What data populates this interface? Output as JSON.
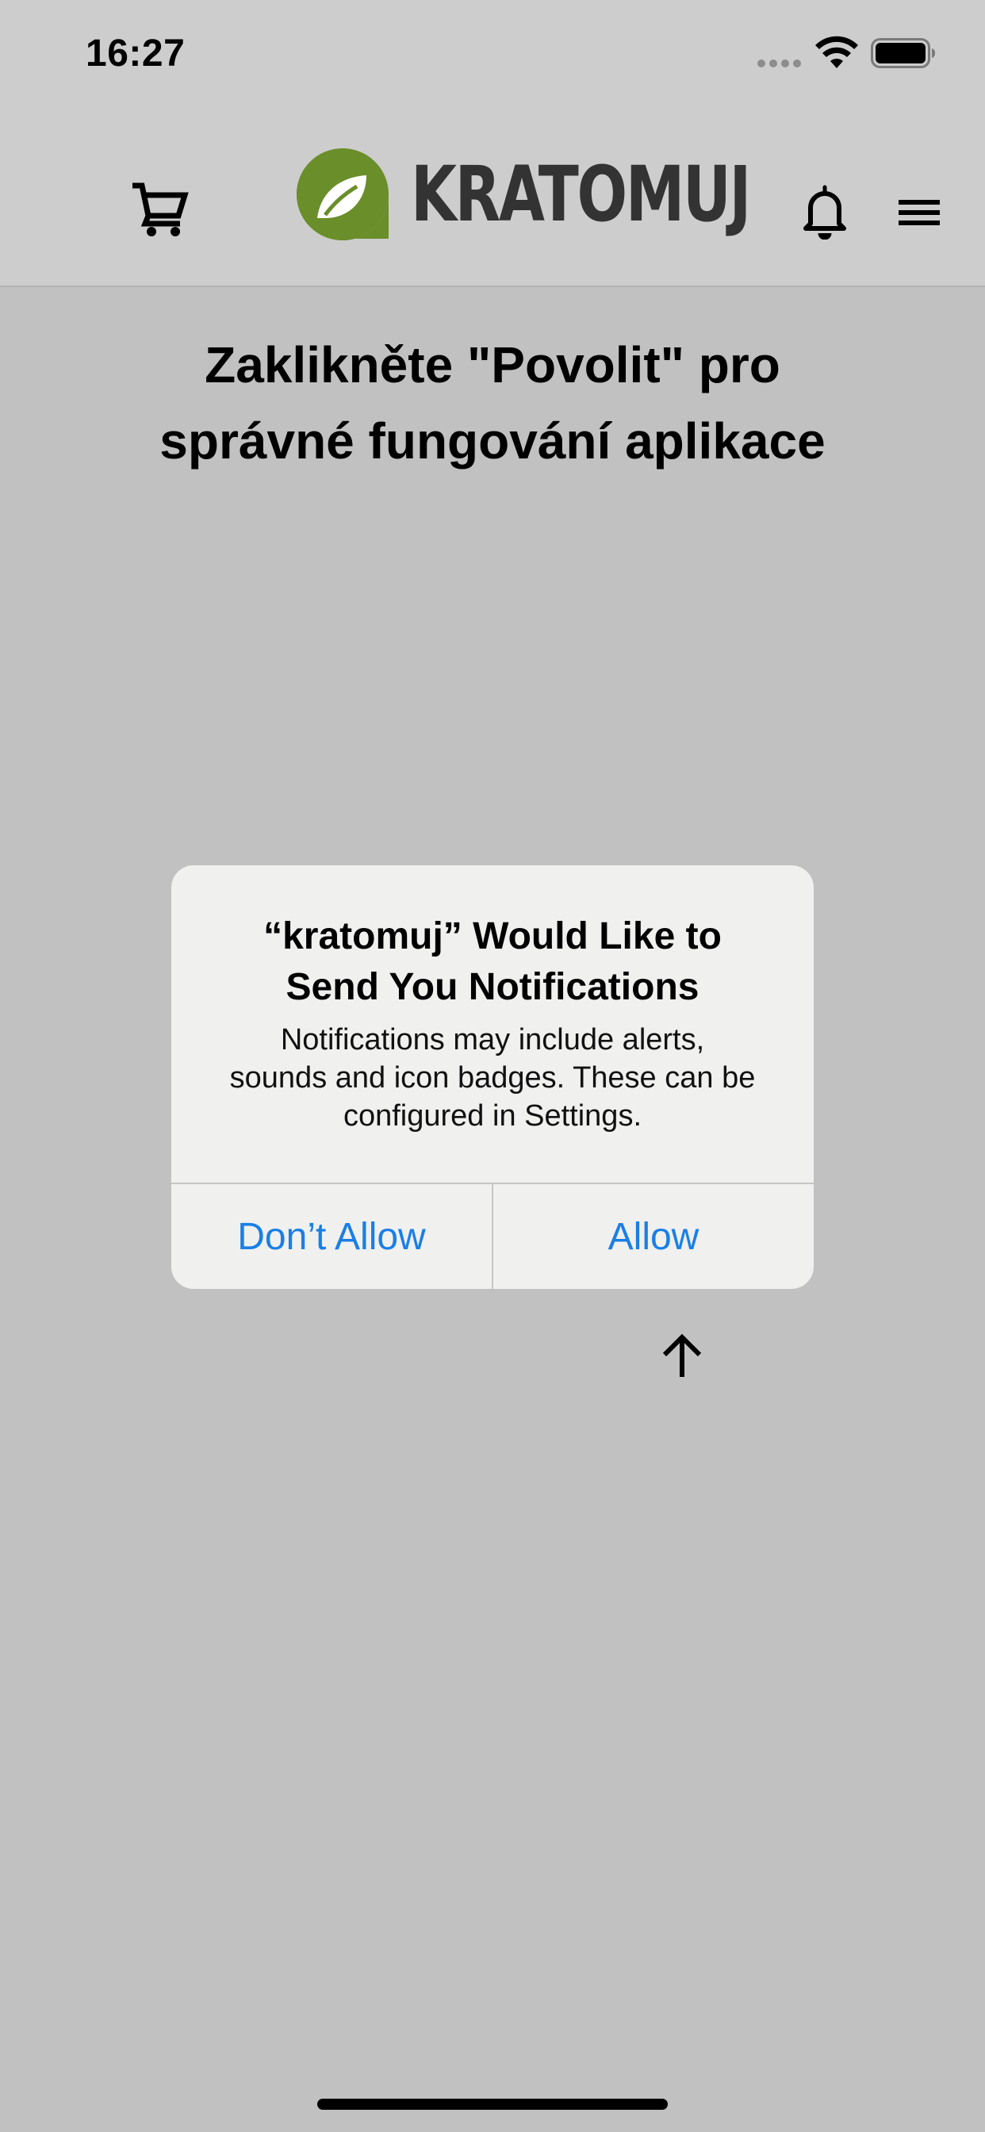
{
  "status_bar": {
    "time": "16:27",
    "icons": [
      "signal-dots-icon",
      "wifi-icon",
      "battery-icon"
    ]
  },
  "header": {
    "logo_text": "KRATOMUJ",
    "brand_color": "#6a8e2a",
    "icons": [
      "cart-icon",
      "bell-icon",
      "menu-icon"
    ]
  },
  "page": {
    "heading_line1": "Zaklikněte \"Povolit\" pro",
    "heading_line2": "správné fungování aplikace"
  },
  "alert": {
    "title_line1": "“kratomuj” Would Like to",
    "title_line2": "Send You Notifications",
    "message_line1": "Notifications may include alerts,",
    "message_line2": "sounds and icon badges. These can be",
    "message_line3": "configured in Settings.",
    "deny_label": "Don’t Allow",
    "allow_label": "Allow",
    "button_color": "#1a7fe6"
  },
  "hint": {
    "icon": "arrow-up-icon"
  }
}
